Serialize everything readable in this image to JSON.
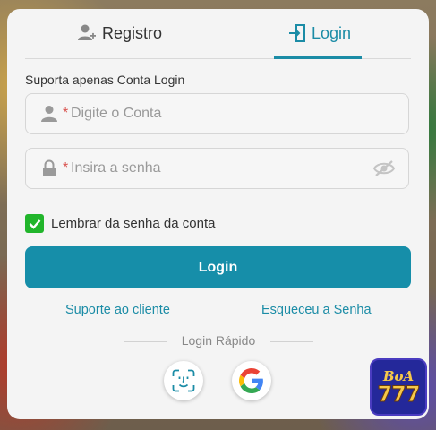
{
  "tabs": {
    "register_label": "Registro",
    "login_label": "Login"
  },
  "note": "Suporta apenas Conta Login",
  "form": {
    "account_placeholder": "Digite o Conta",
    "password_placeholder": "Insira a senha",
    "required_mark": "*",
    "remember_label": "Lembrar da senha da conta",
    "remember_checked": true,
    "login_button": "Login"
  },
  "links": {
    "support": "Suporte ao cliente",
    "forgot": "Esqueceu a Senha"
  },
  "quick_login": {
    "label": "Login Rápido",
    "options": [
      "face-id",
      "google"
    ]
  },
  "badge": {
    "line1": "BoA",
    "line2": "777"
  },
  "colors": {
    "accent": "#1b8ca6",
    "button": "#168ea9",
    "checkbox": "#21b52b",
    "required": "#d9534f"
  }
}
